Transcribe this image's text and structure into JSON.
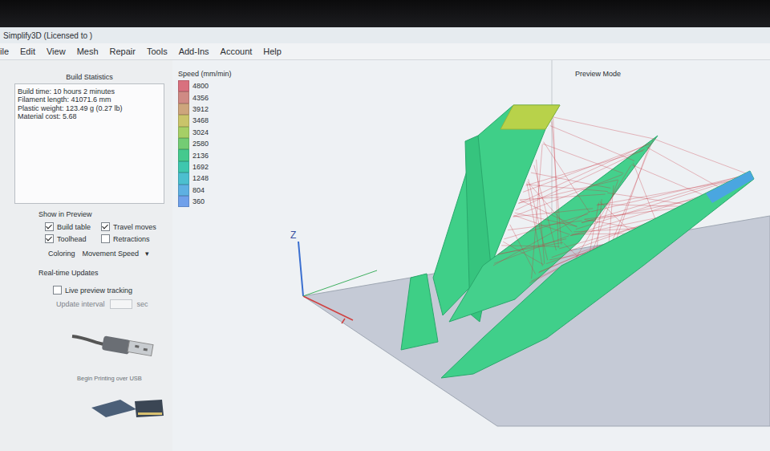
{
  "window": {
    "title": "Simplify3D (Licensed to )"
  },
  "menu": [
    "ile",
    "Edit",
    "View",
    "Mesh",
    "Repair",
    "Tools",
    "Add-Ins",
    "Account",
    "Help"
  ],
  "build_statistics": {
    "title": "Build Statistics",
    "lines": [
      "Build time: 10 hours 2 minutes",
      "Filament length: 41071.6 mm",
      "Plastic weight: 123.49 g (0.27 lb)",
      "Material cost: 5.68"
    ]
  },
  "show_in_preview": {
    "title": "Show in Preview",
    "options": [
      {
        "label": "Build table",
        "checked": true
      },
      {
        "label": "Travel moves",
        "checked": true
      },
      {
        "label": "Toolhead",
        "checked": true
      },
      {
        "label": "Retractions",
        "checked": false
      }
    ]
  },
  "coloring": {
    "label": "Coloring",
    "value": "Movement Speed",
    "arrow": "▾"
  },
  "realtime": {
    "title": "Real-time Updates",
    "tracking": {
      "label": "Live preview tracking",
      "checked": false
    },
    "interval": {
      "label": "Update interval",
      "unit": "sec",
      "disabled": true
    }
  },
  "usb": {
    "label": "Begin Printing over USB"
  },
  "preview": {
    "mode": "Preview Mode",
    "axis_label": "Z",
    "legend": {
      "title": "Speed (mm/min)",
      "items": [
        {
          "value": "4800",
          "color": "#d9707e"
        },
        {
          "value": "4356",
          "color": "#cf8a84"
        },
        {
          "value": "3912",
          "color": "#cda57c"
        },
        {
          "value": "3468",
          "color": "#c9c46a"
        },
        {
          "value": "3024",
          "color": "#a6cf66"
        },
        {
          "value": "2580",
          "color": "#74cc74"
        },
        {
          "value": "2136",
          "color": "#45c98e"
        },
        {
          "value": "1692",
          "color": "#3fc7ae"
        },
        {
          "value": "1248",
          "color": "#4cbfcf"
        },
        {
          "value": "804",
          "color": "#5eb0e2"
        },
        {
          "value": "360",
          "color": "#6fa0ea"
        }
      ]
    }
  }
}
